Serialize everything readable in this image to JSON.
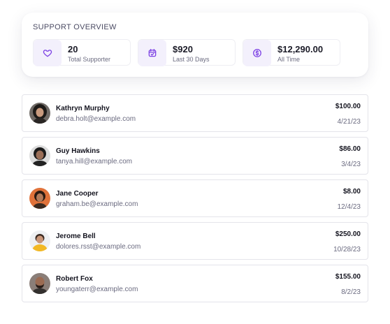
{
  "overview": {
    "title": "SUPPORT OVERVIEW",
    "accent": "#7b3fe4",
    "stats": [
      {
        "value": "20",
        "label": "Total Supporter",
        "icon": "heart-icon"
      },
      {
        "value": "$920",
        "label": "Last 30 Days",
        "icon": "calendar-icon"
      },
      {
        "value": "$12,290.00",
        "label": "All Time",
        "icon": "dollar-icon"
      }
    ]
  },
  "supporters": [
    {
      "name": "Kathryn Murphy",
      "email": "debra.holt@example.com",
      "amount": "$100.00",
      "date": "4/21/23"
    },
    {
      "name": "Guy Hawkins",
      "email": "tanya.hill@example.com",
      "amount": "$86.00",
      "date": "3/4/23"
    },
    {
      "name": "Jane Cooper",
      "email": "graham.be@example.com",
      "amount": "$8.00",
      "date": "12/4/23"
    },
    {
      "name": "Jerome Bell",
      "email": "dolores.rsst@example.com",
      "amount": "$250.00",
      "date": "10/28/23"
    },
    {
      "name": "Robert Fox",
      "email": "youngaterr@example.com",
      "amount": "$155.00",
      "date": "8/2/23"
    }
  ]
}
